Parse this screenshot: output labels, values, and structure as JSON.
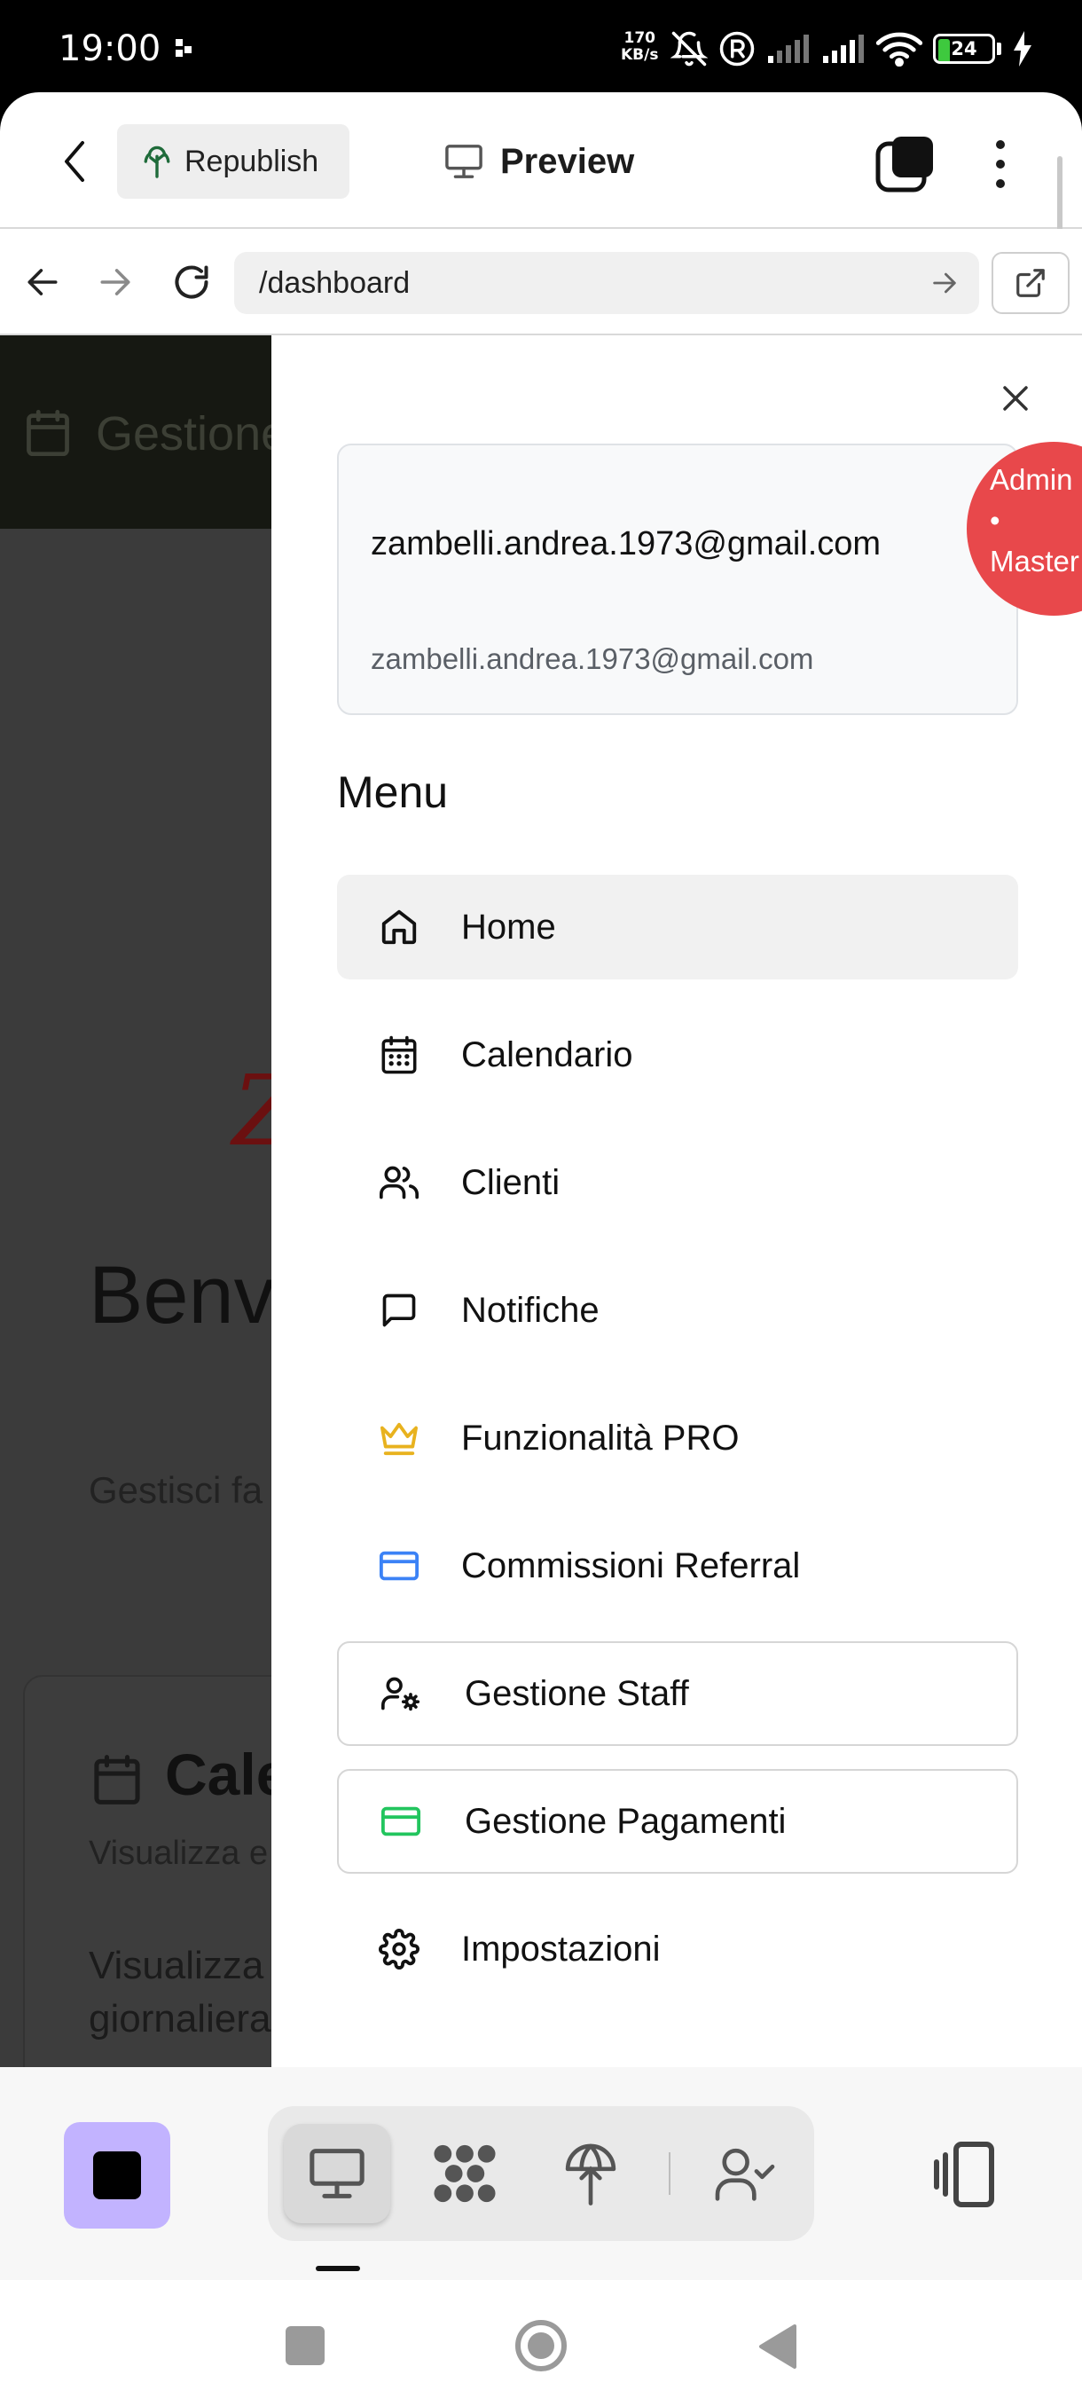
{
  "status_bar": {
    "time": "19:00",
    "net_speed_value": "170",
    "net_speed_unit": "KB/s",
    "battery": "24",
    "battery_level": 0.24
  },
  "header": {
    "republish_label": "Republish",
    "preview_label": "Preview"
  },
  "url_bar": {
    "url": "/dashboard"
  },
  "background_page": {
    "topbar_title": "Gestione",
    "logo_letter": "Z",
    "welcome": "Benve",
    "subtitle": "Gestisci fa",
    "card_title": "Cale",
    "card_subtitle": "Visualizza e",
    "card_body_line1": "Visualizza",
    "card_body_line2": "giornaliera"
  },
  "drawer": {
    "user": {
      "name": "zambelli.andrea.1973@gmail.com",
      "email": "zambelli.andrea.1973@gmail.com",
      "role_line1": "Admin",
      "role_line2": "•",
      "role_line3": "Master"
    },
    "menu_heading": "Menu",
    "items": [
      {
        "label": "Home",
        "icon": "home-icon"
      },
      {
        "label": "Calendario",
        "icon": "calendar-icon"
      },
      {
        "label": "Clienti",
        "icon": "users-icon"
      },
      {
        "label": "Notifiche",
        "icon": "message-icon"
      },
      {
        "label": "Funzionalità PRO",
        "icon": "crown-icon"
      },
      {
        "label": "Commissioni Referral",
        "icon": "credit-card-icon"
      },
      {
        "label": "Gestione Staff",
        "icon": "user-cog-icon"
      },
      {
        "label": "Gestione Pagamenti",
        "icon": "credit-card-icon"
      },
      {
        "label": "Impostazioni",
        "icon": "gear-icon"
      }
    ]
  },
  "colors": {
    "role_badge": "#e8484b",
    "crown": "#e8b21e",
    "referral_card": "#3b82f6",
    "payments_card": "#22c55e",
    "stop_button": "#c2b3ff",
    "battery": "#3ec93e"
  }
}
